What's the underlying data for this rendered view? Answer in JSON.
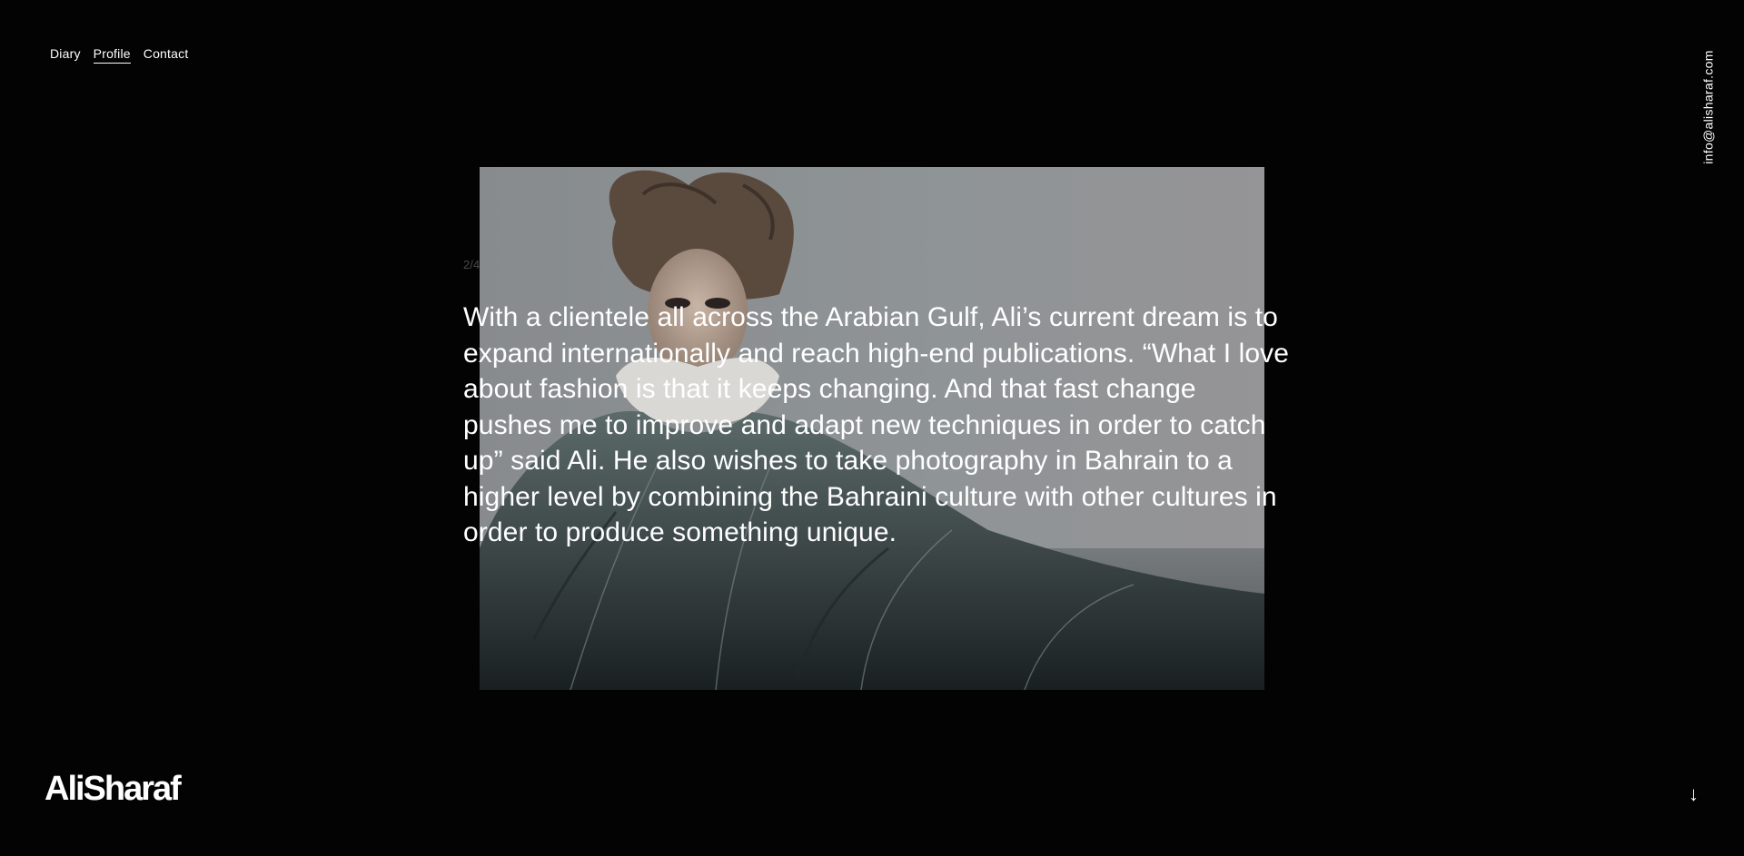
{
  "nav": {
    "items": [
      {
        "label": "Diary",
        "active": false
      },
      {
        "label": "Profile",
        "active": true
      },
      {
        "label": "Contact",
        "active": false
      }
    ]
  },
  "contact": {
    "email": "info@alisharaf.com"
  },
  "slide": {
    "counter": "2/4",
    "text": "With a clientele all across the Arabian Gulf, Ali’s current dream is to expand internationally and reach high-end publications. “What I love about fashion is that it keeps changing. And that fast change pushes me to improve and adapt new techniques in order to catch up” said Ali. He also wishes to take photography in Bahrain to a higher level by combining the Bahraini culture with other cultures in order to produce something unique."
  },
  "brand": {
    "logo": "AliSharaf"
  },
  "icons": {
    "scroll": "arrow-down-icon"
  },
  "colors": {
    "background": "#030303",
    "text": "#ffffff",
    "counter": "#4a4a4a"
  }
}
